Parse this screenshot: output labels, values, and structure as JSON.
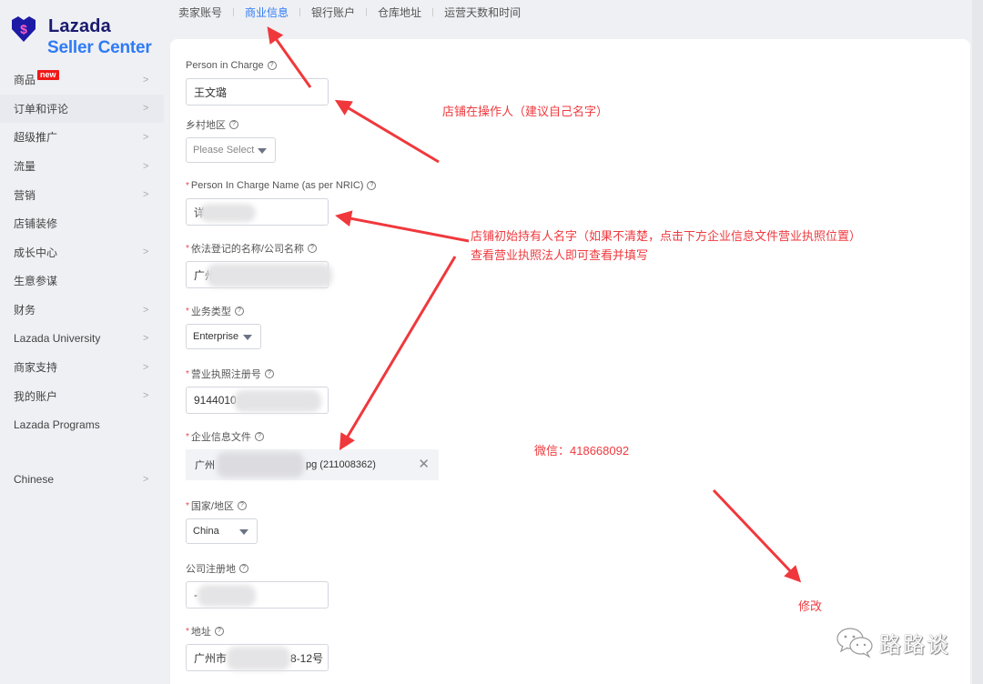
{
  "brand": {
    "name": "Lazada",
    "product": "Seller Center",
    "logo_icon": "lazada-heart-logo",
    "colors": {
      "navy": "#1a1a6e",
      "blue": "#2f7bf5",
      "accent_red": "#ef3a3f"
    }
  },
  "sidebar": {
    "items": [
      {
        "label": "商品",
        "badge": "new",
        "chevron": true
      },
      {
        "label": "订单和评论",
        "chevron": true
      },
      {
        "label": "超级推广",
        "chevron": true
      },
      {
        "label": "流量",
        "chevron": true
      },
      {
        "label": "营销",
        "chevron": true
      },
      {
        "label": "店铺装修",
        "chevron": false
      },
      {
        "label": "成长中心",
        "chevron": true
      },
      {
        "label": "生意参谋",
        "chevron": false
      },
      {
        "label": "财务",
        "chevron": true
      },
      {
        "label": "Lazada University",
        "chevron": true
      },
      {
        "label": "商家支持",
        "chevron": true
      },
      {
        "label": "我的账户",
        "chevron": true
      },
      {
        "label": "Lazada Programs",
        "chevron": false
      }
    ],
    "language": {
      "label": "Chinese",
      "chevron": true
    },
    "chevron_glyph": ">"
  },
  "tabs": [
    {
      "label": "卖家账号",
      "active": false
    },
    {
      "label": "商业信息",
      "active": true
    },
    {
      "label": "银行账户",
      "active": false
    },
    {
      "label": "仓库地址",
      "active": false
    },
    {
      "label": "运营天数和时间",
      "active": false
    }
  ],
  "form": {
    "help_glyph": "?",
    "required_mark": "*",
    "person_in_charge": {
      "label": "Person in Charge",
      "value": "王文璐"
    },
    "rural_area": {
      "label": "乡村地区",
      "placeholder": "Please Select"
    },
    "pic_name_nric": {
      "label": "Person In Charge Name (as per NRIC)",
      "value": "详",
      "required": true
    },
    "company_name": {
      "label": "依法登记的名称/公司名称",
      "value": "广州",
      "required": true
    },
    "business_type": {
      "label": "业务类型",
      "value": "Enterprise",
      "required": true
    },
    "business_license_no": {
      "label": "营业执照注册号",
      "value": "9144010",
      "required": true
    },
    "company_docs": {
      "label": "企业信息文件",
      "file_prefix": "广州",
      "file_suffix": "pg (211008362)",
      "required": true
    },
    "country": {
      "label": "国家/地区",
      "value": "China",
      "required": true
    },
    "registered_place": {
      "label": "公司注册地",
      "value": "-"
    },
    "address": {
      "label": "地址",
      "value_prefix": "广州市",
      "value_suffix": "8-12号",
      "required": true
    }
  },
  "annotations": {
    "operator_note": "店铺在操作人（建议自己名字）",
    "owner_note_line1": "店铺初始持有人名字（如果不清楚，点击下方企业信息文件营业执照位置）",
    "owner_note_line2": "查看营业执照法人即可查看并填写",
    "wechat": "微信：418668092",
    "modify": "修改"
  },
  "watermark": {
    "icon": "wechat-icon",
    "text": "路路谈"
  }
}
